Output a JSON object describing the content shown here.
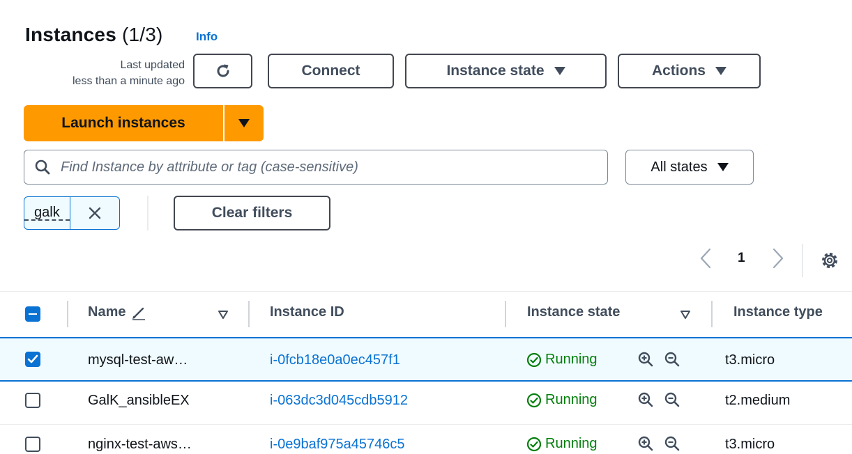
{
  "header": {
    "title": "Instances",
    "count": "(1/3)",
    "info": "Info",
    "last_updated_line1": "Last updated",
    "last_updated_line2": "less than a minute ago"
  },
  "toolbar": {
    "connect": "Connect",
    "instance_state": "Instance state",
    "actions": "Actions",
    "launch": "Launch instances"
  },
  "search": {
    "placeholder": "Find Instance by attribute or tag (case-sensitive)",
    "states_select": "All states"
  },
  "filters": {
    "token": "galk",
    "clear": "Clear filters"
  },
  "pagination": {
    "page": "1"
  },
  "table": {
    "columns": {
      "name": "Name",
      "instance_id": "Instance ID",
      "instance_state": "Instance state",
      "instance_type": "Instance type"
    },
    "rows": [
      {
        "name": "mysql-test-aw…",
        "id": "i-0fcb18e0a0ec457f1",
        "state": "Running",
        "type": "t3.micro",
        "selected": true
      },
      {
        "name": "GalK_ansibleEX",
        "id": "i-063dc3d045cdb5912",
        "state": "Running",
        "type": "t2.medium",
        "selected": false
      },
      {
        "name": "nginx-test-aws…",
        "id": "i-0e9baf975a45746c5",
        "state": "Running",
        "type": "t3.micro",
        "selected": false
      }
    ]
  },
  "colors": {
    "primary": "#ff9900",
    "link": "#0972d3",
    "success": "#037f0c",
    "selected_bg": "#f0fbff"
  }
}
